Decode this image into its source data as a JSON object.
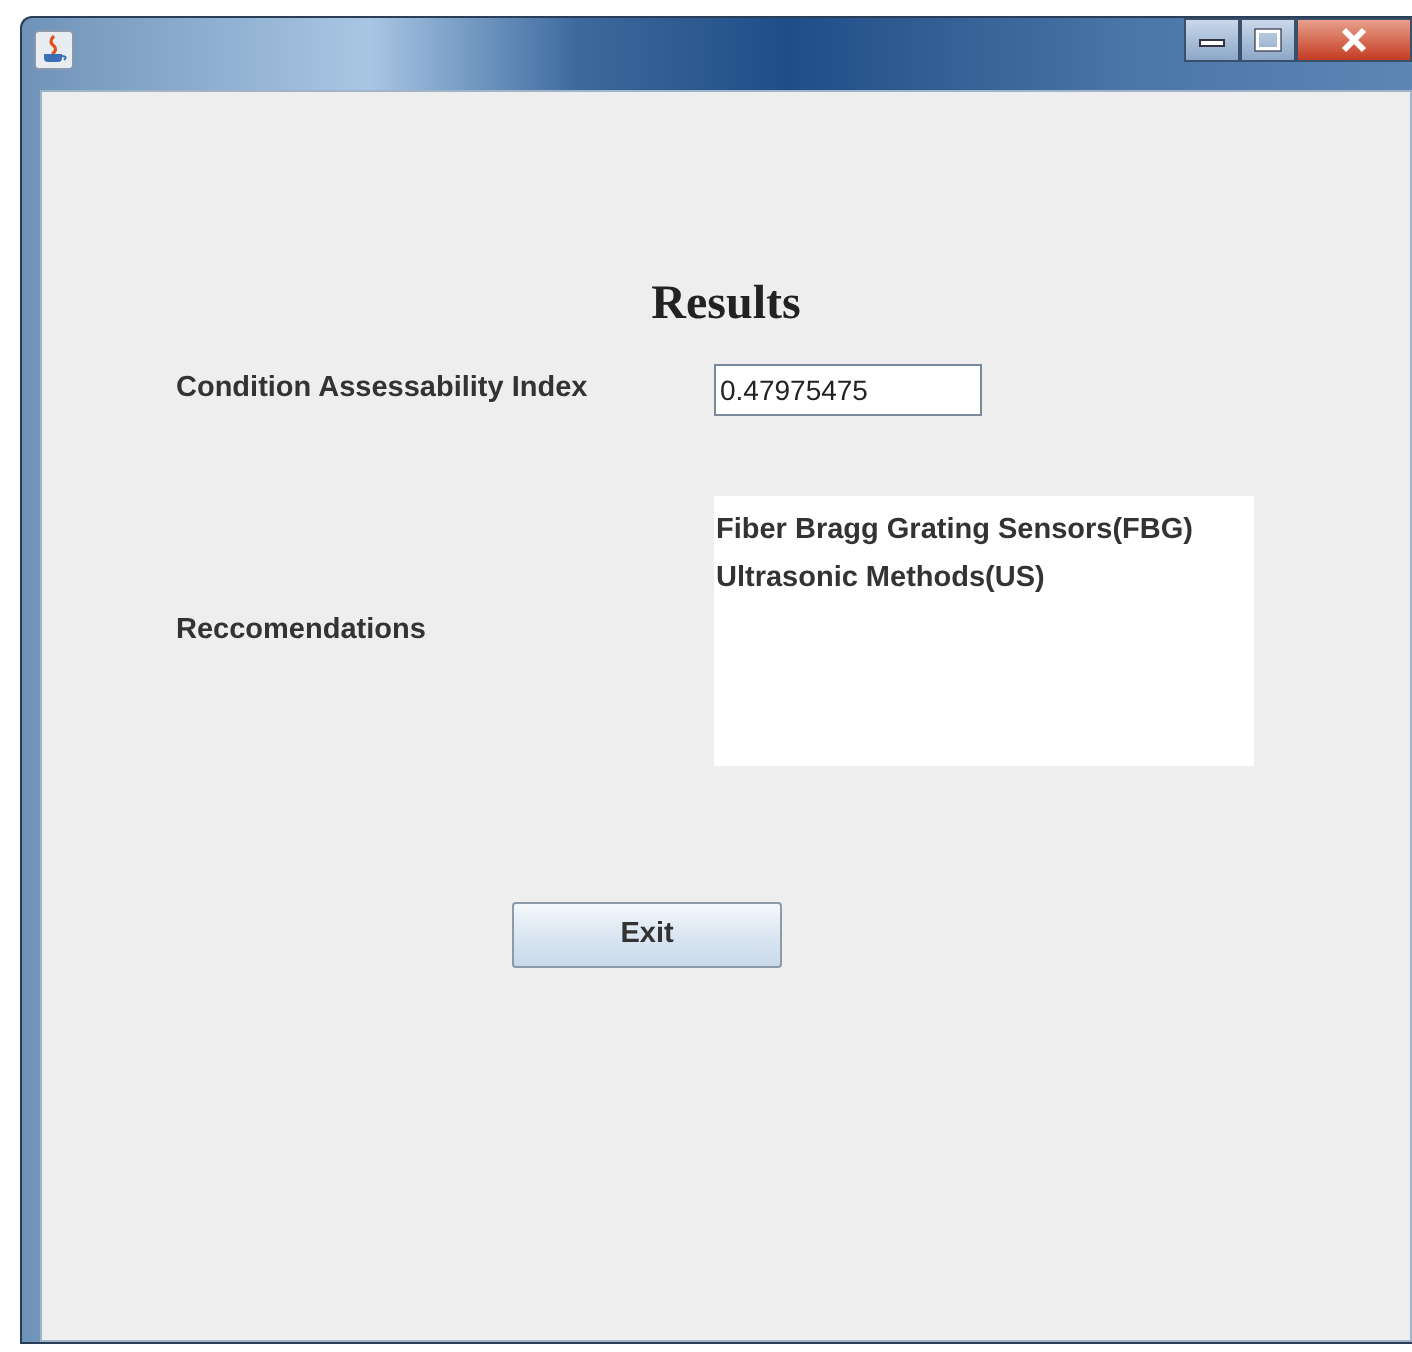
{
  "window": {
    "title_controls": [
      {
        "kind": "minimize"
      },
      {
        "kind": "maximize"
      },
      {
        "kind": "close"
      }
    ]
  },
  "heading": "Results",
  "index": {
    "label": "Condition Assessability Index",
    "value": "0.47975475"
  },
  "recommendations": {
    "label": "Reccomendations",
    "items": [
      "Fiber Bragg Grating Sensors(FBG)",
      "Ultrasonic Methods(US)"
    ]
  },
  "buttons": [
    "Exit"
  ]
}
